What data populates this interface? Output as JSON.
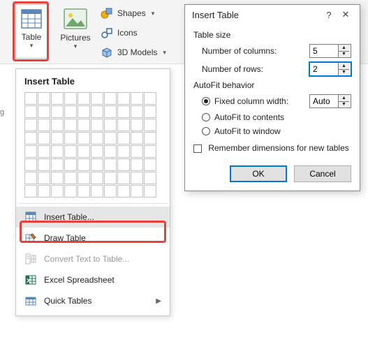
{
  "ribbon": {
    "table_label": "Table",
    "pictures_label": "Pictures",
    "shapes_label": "Shapes",
    "icons_label": "Icons",
    "models_label": "3D Models"
  },
  "menu": {
    "title": "Insert Table",
    "insert_table": "Insert Table...",
    "draw_table": "Draw Table",
    "convert_text": "Convert Text to Table...",
    "excel_spreadsheet": "Excel Spreadsheet",
    "quick_tables": "Quick Tables"
  },
  "dialog": {
    "title": "Insert Table",
    "group_size": "Table size",
    "cols_label": "Number of columns:",
    "cols_value": "5",
    "rows_label": "Number of rows:",
    "rows_value": "2",
    "group_autofit": "AutoFit behavior",
    "fixed_label": "Fixed column width:",
    "fixed_value": "Auto",
    "autofit_contents_label": "AutoFit to contents",
    "autofit_window_label": "AutoFit to window",
    "remember_label": "Remember dimensions for new tables",
    "ok_label": "OK",
    "cancel_label": "Cancel"
  },
  "left_edge_label": "g"
}
